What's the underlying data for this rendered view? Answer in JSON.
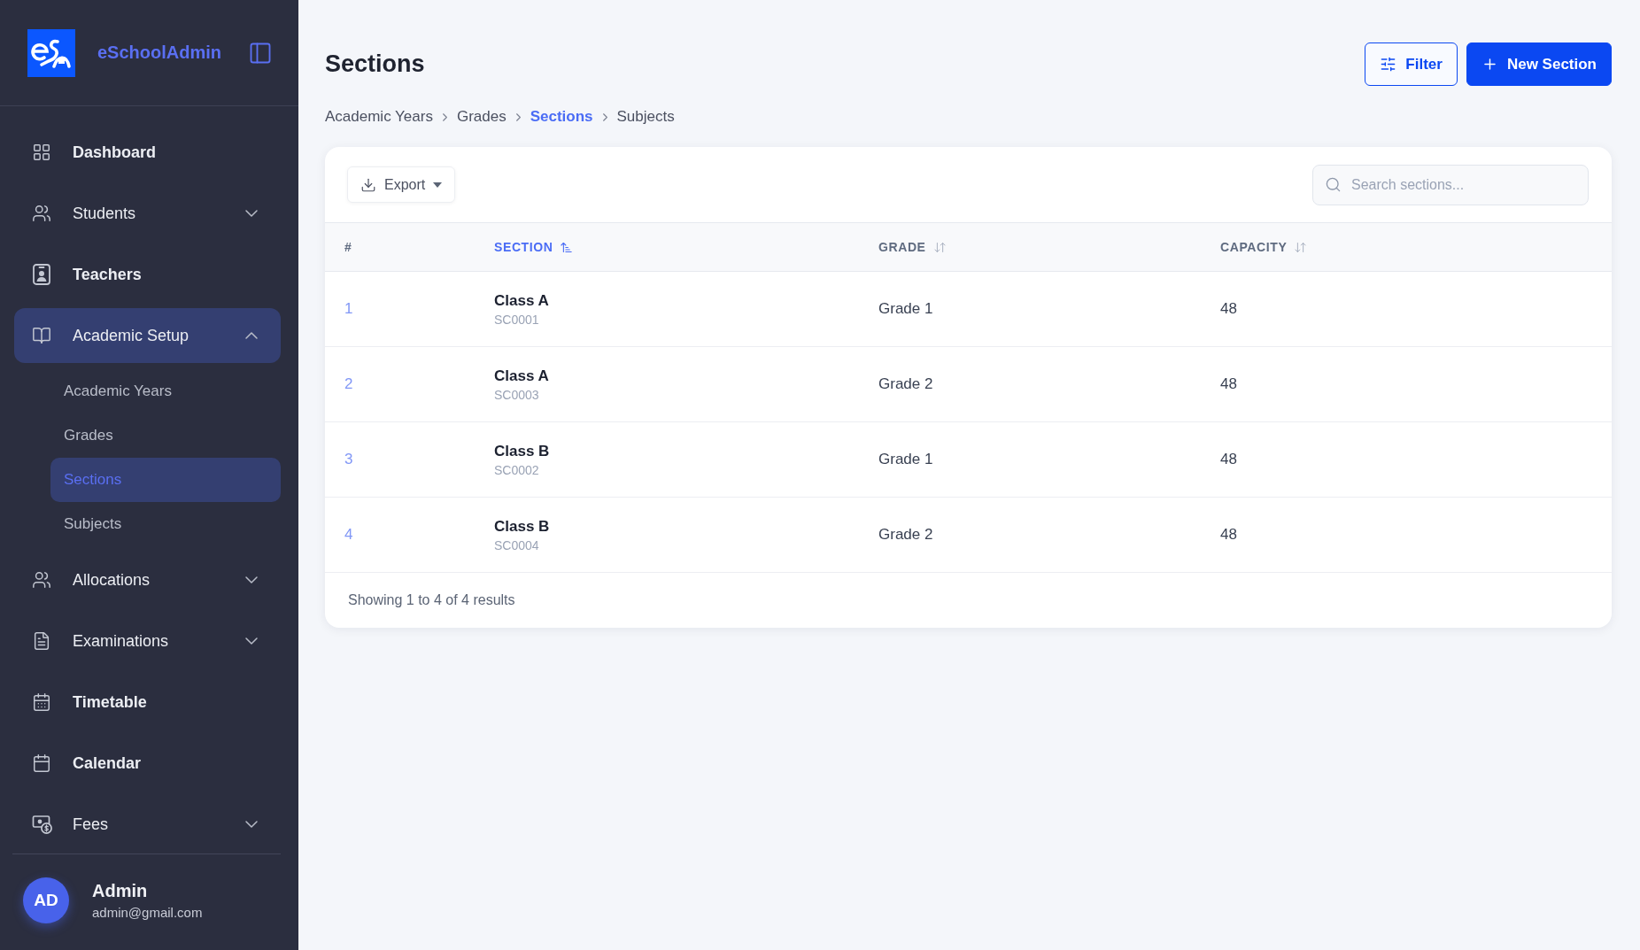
{
  "sidebar": {
    "brand": "eSchoolAdmin",
    "nav": [
      {
        "label": "Dashboard",
        "kind": "link",
        "selected": false
      },
      {
        "label": "Students",
        "kind": "group",
        "expanded": false,
        "selected": false
      },
      {
        "label": "Teachers",
        "kind": "link",
        "selected": false
      },
      {
        "label": "Academic Setup",
        "kind": "group",
        "expanded": true,
        "selected": true,
        "children": [
          {
            "label": "Academic Years",
            "selected": false
          },
          {
            "label": "Grades",
            "selected": false
          },
          {
            "label": "Sections",
            "selected": true
          },
          {
            "label": "Subjects",
            "selected": false
          }
        ]
      },
      {
        "label": "Allocations",
        "kind": "group",
        "expanded": false,
        "selected": false
      },
      {
        "label": "Examinations",
        "kind": "group",
        "expanded": false,
        "selected": false
      },
      {
        "label": "Timetable",
        "kind": "link",
        "selected": false
      },
      {
        "label": "Calendar",
        "kind": "link",
        "selected": false
      },
      {
        "label": "Fees",
        "kind": "group",
        "expanded": false,
        "selected": false
      }
    ],
    "user": {
      "initials": "AD",
      "name": "Admin",
      "email": "admin@gmail.com"
    }
  },
  "header": {
    "title": "Sections",
    "buttons": [
      {
        "label": "Filter",
        "kind": "outline"
      },
      {
        "label": "New Section",
        "kind": "primary"
      }
    ]
  },
  "breadcrumb": [
    {
      "label": "Academic Years",
      "selected": false
    },
    {
      "label": "Grades",
      "selected": false
    },
    {
      "label": "Sections",
      "selected": true
    },
    {
      "label": "Subjects",
      "selected": false
    }
  ],
  "table": {
    "export_button": "Export",
    "search": {
      "placeholder": "Search sections..."
    },
    "columns": [
      {
        "label": "#",
        "sortable": false,
        "sorted": false
      },
      {
        "label": "SECTION",
        "sortable": true,
        "sorted": true
      },
      {
        "label": "GRADE",
        "sortable": true,
        "sorted": false
      },
      {
        "label": "CAPACITY",
        "sortable": true,
        "sorted": false
      }
    ],
    "rows": [
      {
        "number": "1",
        "name": "Class A",
        "code": "SC0001",
        "grade": "Grade 1",
        "capacity": "48"
      },
      {
        "number": "2",
        "name": "Class A",
        "code": "SC0003",
        "grade": "Grade 2",
        "capacity": "48"
      },
      {
        "number": "3",
        "name": "Class B",
        "code": "SC0002",
        "grade": "Grade 1",
        "capacity": "48"
      },
      {
        "number": "4",
        "name": "Class B",
        "code": "SC0004",
        "grade": "Grade 2",
        "capacity": "48"
      }
    ],
    "footer": "Showing 1 to 4 of 4 results"
  }
}
